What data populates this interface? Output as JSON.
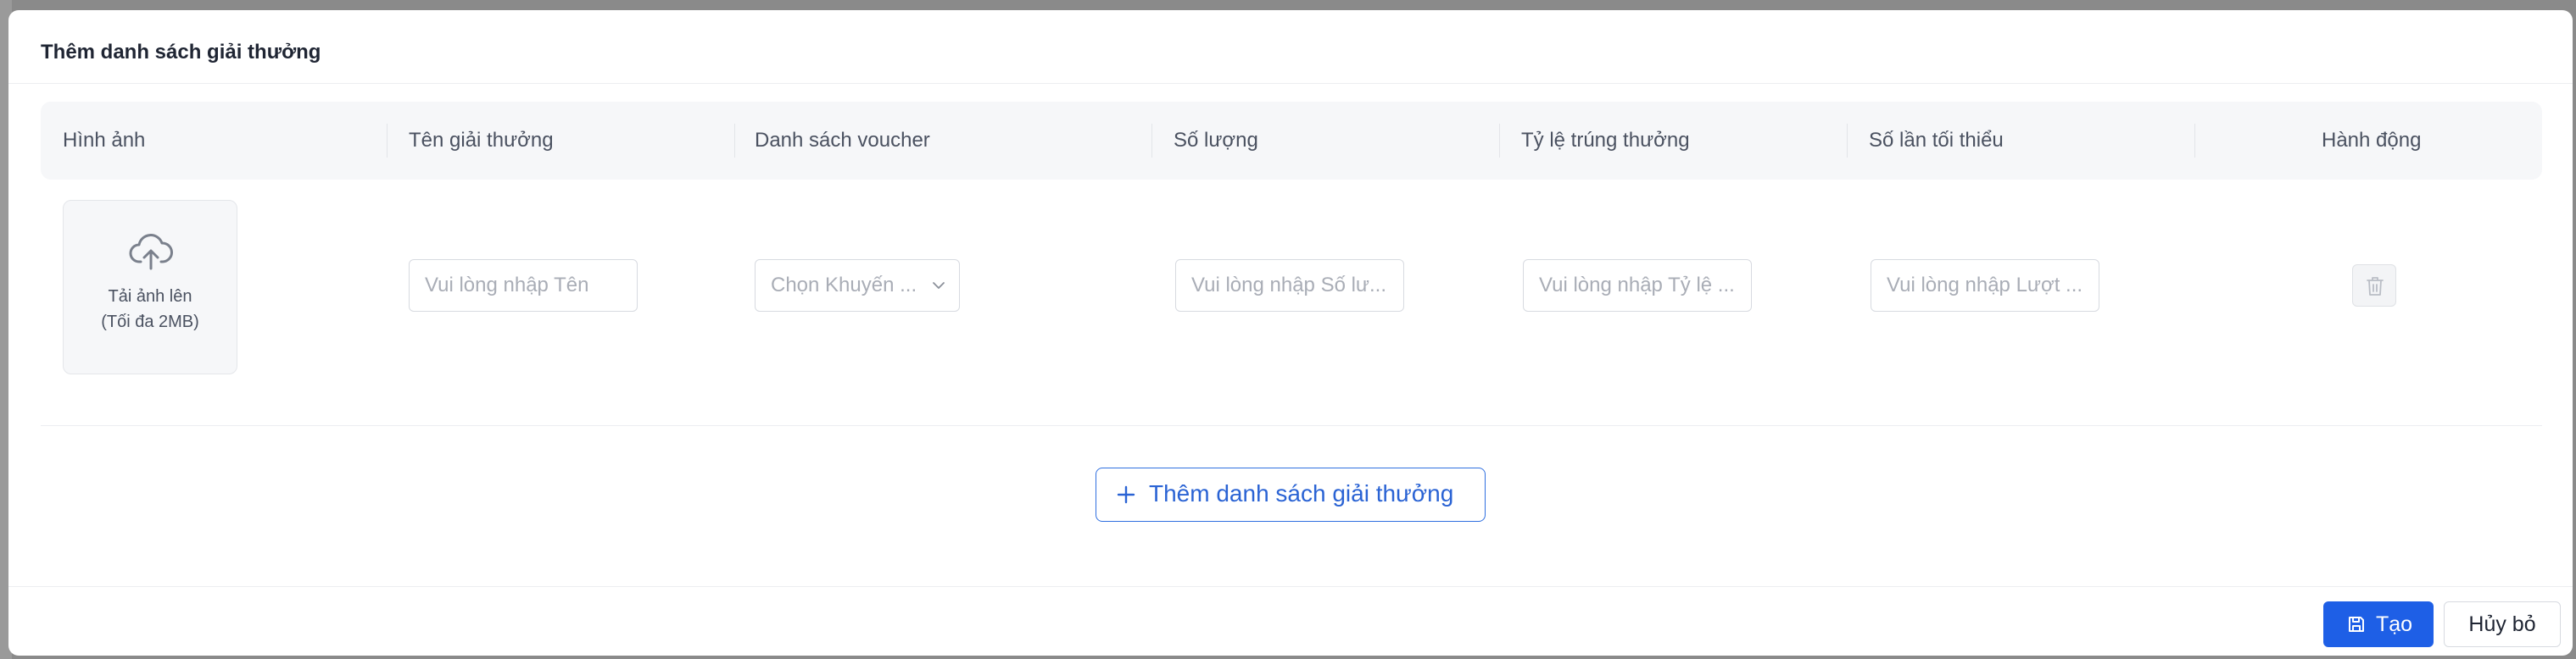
{
  "modal": {
    "title": "Thêm danh sách giải thưởng"
  },
  "table": {
    "columns": [
      "Hình ảnh",
      "Tên giải thưởng",
      "Danh sách voucher",
      "Số lượng",
      "Tỷ lệ trúng thưởng",
      "Số lần tối thiểu",
      "Hành động"
    ],
    "row": {
      "upload_label": "Tải ảnh lên",
      "upload_hint": "(Tối đa 2MB)",
      "name_placeholder": "Vui lòng nhập Tên",
      "voucher_placeholder": "Chọn Khuyến ...",
      "quantity_placeholder": "Vui lòng nhập Số lư...",
      "rate_placeholder": "Vui lòng nhập Tỷ lệ ...",
      "min_times_placeholder": "Vui lòng nhập Lượt ..."
    }
  },
  "actions": {
    "add_prize_list": "Thêm danh sách giải thưởng",
    "create": "Tạo",
    "cancel": "Hủy bỏ"
  },
  "icons": {
    "upload": "cloud-upload-icon",
    "delete": "trash-icon",
    "add": "plus-icon",
    "save": "save-icon",
    "dropdown": "chevron-down-icon"
  },
  "colors": {
    "primary": "#1e5fe6",
    "link": "#2a63d4",
    "header_bg": "#f6f7f9"
  }
}
